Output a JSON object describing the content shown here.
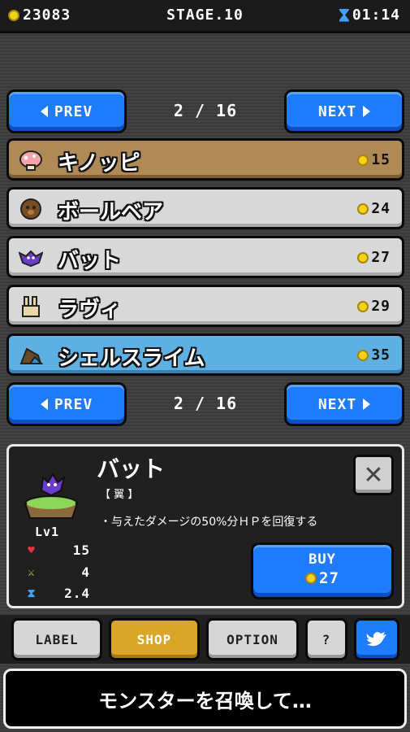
{
  "hud": {
    "coins": "23083",
    "stage": "STAGE.10",
    "timer": "01:14"
  },
  "pager": {
    "prev_label": "PREV",
    "next_label": "NEXT",
    "page": "2 / 16"
  },
  "monsters": [
    {
      "name": "キノッピ",
      "price": "15",
      "state": "locked",
      "icon": "mushroom-icon"
    },
    {
      "name": "ボールベア",
      "price": "24",
      "state": "normal",
      "icon": "ball-bear-icon"
    },
    {
      "name": "バット",
      "price": "27",
      "state": "normal",
      "icon": "bat-icon"
    },
    {
      "name": "ラヴィ",
      "price": "29",
      "state": "normal",
      "icon": "rabbit-icon"
    },
    {
      "name": "シェルスライム",
      "price": "35",
      "state": "selected",
      "icon": "shell-slime-icon"
    }
  ],
  "detail": {
    "name": "バット",
    "type": "【 翼 】",
    "description": "・与えたダメージの50%分ＨＰを回復する",
    "level": "Lv1",
    "stats": {
      "hp": "15",
      "attack": "4",
      "speed": "2.4"
    },
    "buy_label": "BUY",
    "buy_price": "27"
  },
  "menu": {
    "label": "LABEL",
    "shop": "SHOP",
    "option": "OPTION",
    "help": "?",
    "twitter_icon": "twitter-bird-icon"
  },
  "message": "モンスターを召喚して…",
  "colors": {
    "accent_blue": "#1f7bff",
    "active_gold": "#d9a62a",
    "selected_row": "#5fb0e2",
    "locked_row": "#b08a56",
    "coin": "#f4d21c"
  }
}
